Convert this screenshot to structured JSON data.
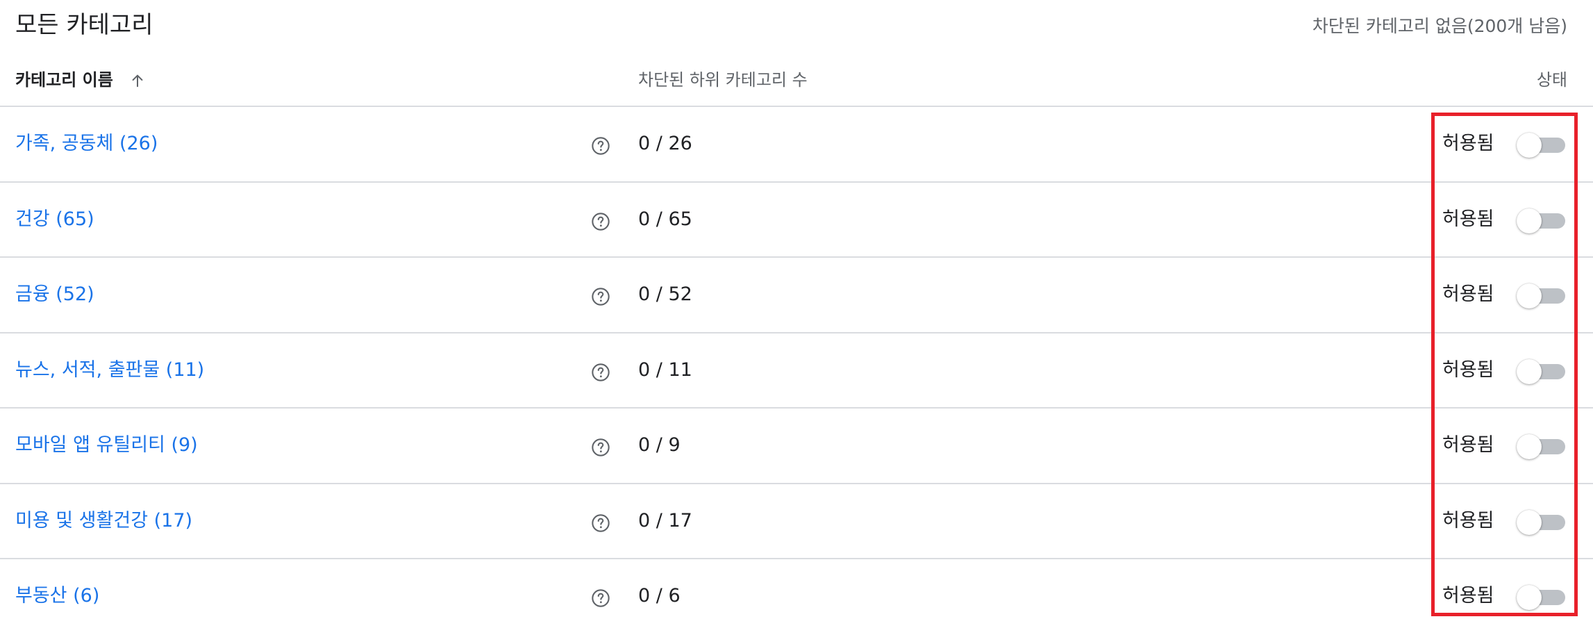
{
  "header": {
    "title": "모든 카테고리",
    "blocked_summary": "차단된 카테고리 없음(200개 남음)"
  },
  "columns": {
    "name": "카테고리 이름",
    "sort_icon": "arrow-up-icon",
    "subcategories": "차단된 하위 카테고리 수",
    "status": "상태"
  },
  "rows": [
    {
      "name": "가족, 공동체 (26)",
      "blocked": "0 / 26",
      "status": "허용됨",
      "toggle_on": false
    },
    {
      "name": "건강 (65)",
      "blocked": "0 / 65",
      "status": "허용됨",
      "toggle_on": false
    },
    {
      "name": "금융 (52)",
      "blocked": "0 / 52",
      "status": "허용됨",
      "toggle_on": false
    },
    {
      "name": "뉴스, 서적, 출판물 (11)",
      "blocked": "0 / 11",
      "status": "허용됨",
      "toggle_on": false
    },
    {
      "name": "모바일 앱 유틸리티 (9)",
      "blocked": "0 / 9",
      "status": "허용됨",
      "toggle_on": false
    },
    {
      "name": "미용 및 생활건강 (17)",
      "blocked": "0 / 17",
      "status": "허용됨",
      "toggle_on": false
    },
    {
      "name": "부동산 (6)",
      "blocked": "0 / 6",
      "status": "허용됨",
      "toggle_on": false
    }
  ],
  "icons": {
    "help": "help-circle-icon",
    "sort": "arrow-up-icon"
  },
  "colors": {
    "link": "#1a73e8",
    "highlight": "#e8202a",
    "toggle_track_off": "#bdc1c6",
    "divider": "#dadce0"
  }
}
